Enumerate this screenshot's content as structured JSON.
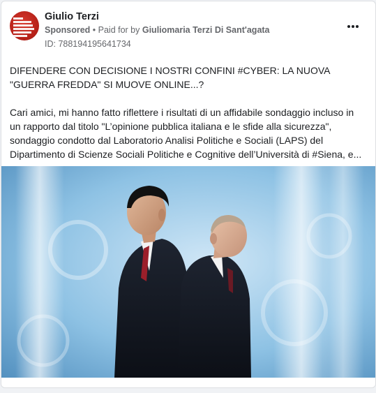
{
  "post": {
    "author": "Giulio Terzi",
    "sponsored_label": "Sponsored",
    "separator": " • ",
    "paid_for_prefix": "Paid for by ",
    "paid_for_name": "Giuliomaria Terzi Di Sant'agata",
    "ad_id": "ID: 788194195641734",
    "more_icon": "more-horizontal-icon",
    "headline": "DIFENDERE CON DECISIONE I NOSTRI CONFINI #CYBER: LA NUOVA \"GUERRA FREDDA\" SI MUOVE ONLINE...?",
    "body": "Cari amici, mi hanno fatto riflettere i risultati di un affidabile sondaggio incluso in un rapporto dal titolo \"L’opinione pubblica italiana e le sfide alla sicurezza\", sondaggio condotto dal Laboratorio Analisi Politiche e Sociali (LAPS) del Dipartimento di Scienze Sociali Politiche e Cognitive dell’Università di #Siena, e..."
  },
  "avatar": {
    "text": "TUTTI GLI ESSERI UMANI NASCONO LIBERI ED EGUALI IN DIGNITÀ E DIRITTI",
    "color": "#c0221a"
  },
  "colors": {
    "text_primary": "#1c1e21",
    "text_secondary": "#65676b",
    "card_bg": "#ffffff",
    "page_bg": "#f0f2f5"
  }
}
